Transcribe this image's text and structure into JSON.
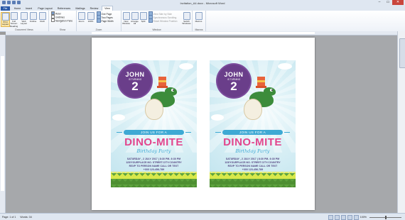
{
  "window": {
    "title": "Invitation_A4.docx - Microsoft Word",
    "controls": [
      "–",
      "▭",
      "✕"
    ]
  },
  "tabs": [
    "File",
    "Home",
    "Insert",
    "Page Layout",
    "References",
    "Mailings",
    "Review",
    "View"
  ],
  "active_tab": "View",
  "ribbon": {
    "document_views": {
      "label": "Document Views",
      "buttons": [
        "Print Layout",
        "Full Screen Reading",
        "Web Layout",
        "Outline",
        "Draft"
      ]
    },
    "show": {
      "label": "Show",
      "items": [
        {
          "text": "Ruler",
          "checked": true
        },
        {
          "text": "Gridlines",
          "checked": false
        },
        {
          "text": "Navigation Pane",
          "checked": false
        }
      ]
    },
    "zoom": {
      "label": "Zoom",
      "buttons": [
        "Zoom",
        "100%"
      ],
      "small": [
        "One Page",
        "Two Pages",
        "Page Width"
      ]
    },
    "window": {
      "label": "Window",
      "buttons": [
        "New Window",
        "Arrange All",
        "Split"
      ],
      "small": [
        "View Side by Side",
        "Synchronous Scrolling",
        "Reset Window Position"
      ],
      "switch": "Switch Windows"
    },
    "macros": {
      "label": "Macros",
      "button": "Macros"
    }
  },
  "cards": [
    {
      "name": "JOHN",
      "subtitle": "IS TURNING",
      "age": "2",
      "join": "JOIN US FOR A",
      "headline": "DINO-MITE",
      "script": "Birthday Party",
      "details": [
        "SATURDAY , 2 JULY 2017 | 8:30 PM- 6:30 PM",
        "123/YOURPLACE.NO. STREET.CITY.COUNTRY",
        "RSVP TO PERSON NAME CALL OR TEXT",
        "+000 123-456-789"
      ]
    },
    {
      "name": "JOHN",
      "subtitle": "IS TURNING",
      "age": "2",
      "join": "JOIN US FOR A",
      "headline": "DINO-MITE",
      "script": "Birthday Party",
      "details": [
        "SATURDAY , 2 JULY 2017 | 8:30 PM- 6:30 PM",
        "123/YOURPLACE.NO. STREET.CITY.COUNTRY",
        "RSVP TO PERSON NAME CALL OR TEXT",
        "+000 123-456-789"
      ]
    }
  ],
  "statusbar": {
    "page": "Page: 1 of 1",
    "words": "Words: 34",
    "zoom": "100%"
  },
  "colors": {
    "purple": "#6a3e8a",
    "pink": "#e2468d",
    "blue": "#3ea9d4",
    "green": "#5ea33e",
    "sky": "#d8eff5"
  }
}
